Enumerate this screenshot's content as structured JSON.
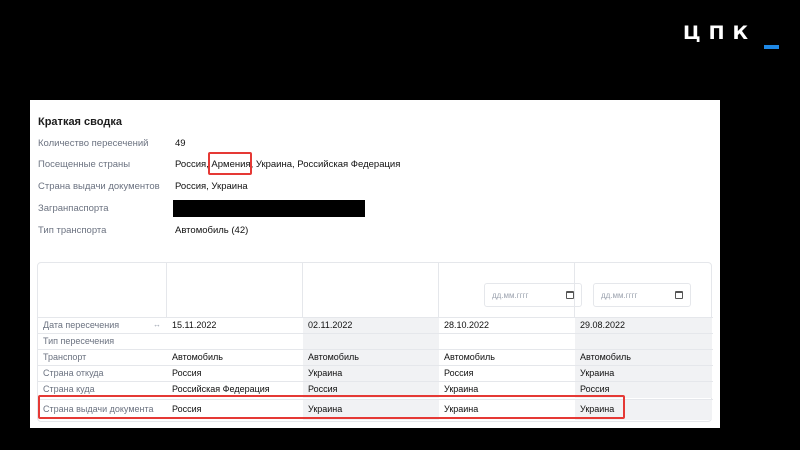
{
  "brand": {
    "logo": "ЦПК",
    "accent": "#1e88e5"
  },
  "summary": {
    "title": "Краткая сводка",
    "rows": [
      {
        "label": "Количество пересечений",
        "value": "49"
      },
      {
        "label": "Посещенные страны",
        "value": "Россия, Армения, Украина, Российская Федерация"
      },
      {
        "label": "Страна выдачи документов",
        "value": "Россия, Украина"
      },
      {
        "label": "Загранпаспорта",
        "value": ""
      },
      {
        "label": "Тип транспорта",
        "value": "Автомобиль (42)"
      }
    ]
  },
  "filters": [
    {
      "placeholder": "дд.мм.гггг",
      "icon": "calendar-icon"
    },
    {
      "placeholder": "дд.мм.гггг",
      "icon": "calendar-icon"
    }
  ],
  "table": {
    "row_labels": [
      "Дата пересечения",
      "Тип пересечения",
      "Транспорт",
      "Страна откуда",
      "Страна куда",
      "Страна выдачи документа"
    ],
    "columns": [
      [
        "15.11.2022",
        "",
        "Автомобиль",
        "Россия",
        "Российская Федерация",
        "Россия"
      ],
      [
        "02.11.2022",
        "",
        "Автомобиль",
        "Украина",
        "Россия",
        "Украина"
      ],
      [
        "28.10.2022",
        "",
        "Автомобиль",
        "Россия",
        "Украина",
        "Украина"
      ],
      [
        "29.08.2022",
        "",
        "Автомобиль",
        "Украина",
        "Россия",
        "Украина"
      ]
    ]
  },
  "highlight_color": "#e53935"
}
